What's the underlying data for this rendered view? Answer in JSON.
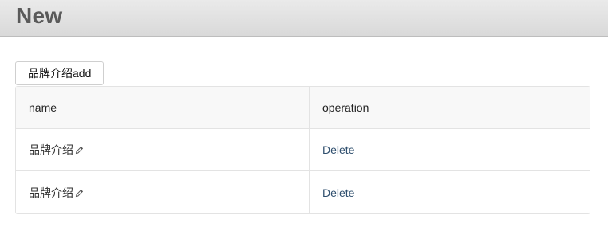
{
  "header": {
    "title": "New"
  },
  "toolbar": {
    "add_label": "品牌介绍add"
  },
  "table": {
    "columns": [
      "name",
      "operation"
    ],
    "rows": [
      {
        "name": "品牌介绍",
        "action": "Delete",
        "edit_icon": "pencil-icon"
      },
      {
        "name": "品牌介绍",
        "action": "Delete",
        "edit_icon": "pencil-icon"
      }
    ]
  },
  "colors": {
    "link": "#2f4f6e",
    "header_text": "#5a5a5a"
  }
}
